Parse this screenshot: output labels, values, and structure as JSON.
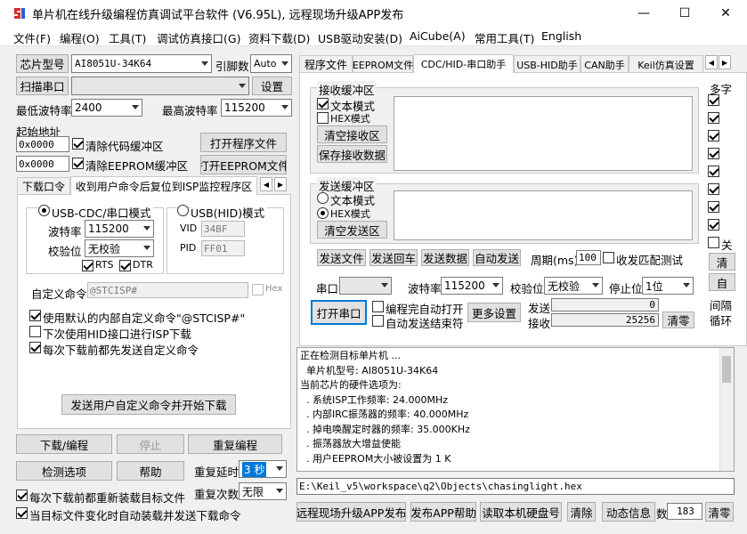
{
  "window": {
    "title": "单片机在线升级编程仿真调试平台软件 (V6.95L), 远程现场升级APP发布",
    "minimize": "—",
    "maximize": "☐",
    "close": "✕"
  },
  "menu": [
    "文件(F)",
    "编程(O)",
    "工具(T)",
    "调试仿真接口(G)",
    "资料下载(D)",
    "USB驱动安装(D)",
    "AiCube(A)",
    "常用工具(T)",
    "English"
  ],
  "left": {
    "chip_type_button": "芯片型号",
    "chip_type_value": "AI8051U-34K64",
    "pin_count_label": "引脚数",
    "pin_count_value": "Auto",
    "scan_port_button": "扫描串口",
    "port_value": "",
    "settings_button": "设置",
    "min_baud_label": "最低波特率",
    "min_baud_value": "2400",
    "max_baud_label": "最高波特率",
    "max_baud_value": "115200",
    "start_addr_label": "起始地址",
    "addr1": "0x0000",
    "clear_code_buffer": "清除代码缓冲区",
    "open_program_button": "打开程序文件",
    "addr2": "0x0000",
    "clear_eeprom_buffer": "清除EEPROM缓冲区",
    "open_eeprom_button": "打开EEPROM文件",
    "tabs": [
      "下载口令",
      "收到用户命令后复位到ISP监控程序区"
    ],
    "usb_cdc_mode": "USB-CDC/串口模式",
    "usb_hid_mode": "USB(HID)模式",
    "baud_label": "波特率",
    "baud_value": "115200",
    "parity_label": "校验位",
    "parity_value": "无校验",
    "vid_label": "VID",
    "vid_value": "34BF",
    "pid_label": "PID",
    "pid_value": "FF01",
    "rts_label": "RTS",
    "dtr_label": "DTR",
    "custom_cmd_label": "自定义命令",
    "custom_cmd_value": "@STCISP#",
    "hex_label": "Hex",
    "opt_default_cmd": "使用默认的内部自定义命令\"@STCISP#\"",
    "opt_hid_next": "下次使用HID接口进行ISP下载",
    "opt_send_before": "每次下载前都先发送自定义命令",
    "send_and_download_button": "发送用户自定义命令并开始下载",
    "download_button": "下载/编程",
    "stop_button": "停止",
    "reprogram_button": "重复编程",
    "detect_button": "检测选项",
    "help_button": "帮助",
    "repeat_delay_label": "重复延时",
    "repeat_delay_value": "3 秒",
    "repeat_count_label": "重复次数",
    "repeat_count_value": "无限",
    "reload_each": "每次下载前都重新装载目标文件",
    "auto_reload": "当目标文件变化时自动装载并发送下载命令"
  },
  "right": {
    "tabs": [
      "程序文件",
      "EEPROM文件",
      "CDC/HID-串口助手",
      "USB-HID助手",
      "CAN助手",
      "Keil仿真设置"
    ],
    "receive_group": "接收缓冲区",
    "rx_text_mode": "文本模式",
    "rx_hex_mode": "HEX模式",
    "clear_rx_button": "清空接收区",
    "save_rx_button": "保存接收数据",
    "send_group": "发送缓冲区",
    "tx_text_mode": "文本模式",
    "tx_hex_mode": "HEX模式",
    "clear_tx_button": "清空发送区",
    "multi_label": "多字",
    "send_file_button": "发送文件",
    "send_enter_button": "发送回车",
    "send_data_button": "发送数据",
    "auto_send_button": "自动发送",
    "period_label": "周期(ms)",
    "period_value": "100",
    "match_test_label": "收发匹配测试",
    "side_partial": "关",
    "side_btn1": "清",
    "side_btn2": "自",
    "interval_partial": "间隔",
    "loop_partial": "循环",
    "port_label": "串口",
    "port_value": "",
    "baud_label": "波特率",
    "baud_value": "115200",
    "parity_label": "校验位",
    "parity_value": "无校验",
    "stop_label": "停止位",
    "stop_value": "1位",
    "open_port_button": "打开串口",
    "auto_open_after_program": "编程完自动打开",
    "auto_send_end": "自动发送结束符",
    "more_settings_button": "更多设置",
    "send_label": "发送",
    "send_count": "0",
    "recv_label": "接收",
    "recv_count": "25256",
    "clear_count_button": "清零"
  },
  "log": [
    "正在检测目标单片机 ...",
    "  单片机型号: AI8051U-34K64",
    "",
    "当前芯片的硬件选项为:",
    "  . 系统ISP工作频率: 24.000MHz",
    "  . 内部IRC振荡器的频率: 40.000MHz",
    "  . 掉电唤醒定时器的频率: 35.000KHz",
    "  . 振荡器放大增益使能",
    "  . 用户EEPROM大小被设置为 1 K"
  ],
  "file_path": "E:\\Keil_v5\\workspace\\q2\\Objects\\chasinglight.hex",
  "bottom": {
    "publish_app_button": "远程现场升级APP发布",
    "publish_help_button": "发布APP帮助",
    "read_disk_button": "读取本机硬盘号",
    "clear_button": "清除",
    "anim_button": "动态信息",
    "count_partial": "数",
    "count_value": "183",
    "reset_button": "清零"
  }
}
